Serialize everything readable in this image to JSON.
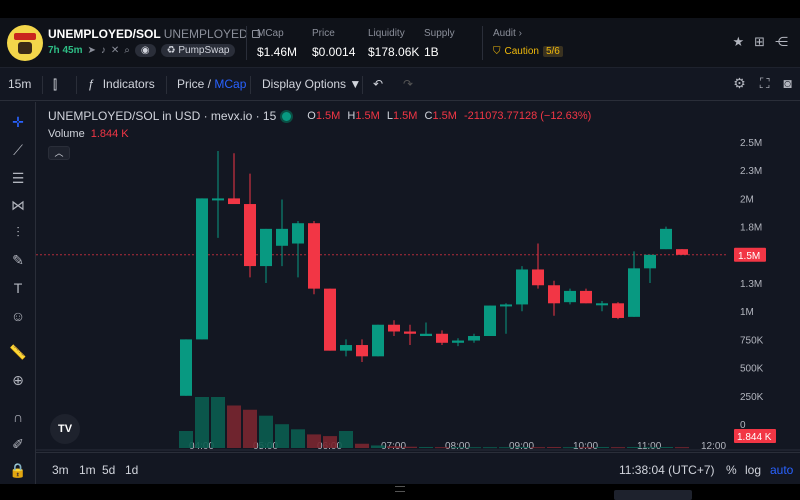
{
  "header": {
    "token_name": "UNEMPLOYED/SOL",
    "token_subname": "UNEMPLOYED",
    "age": "7h 45m",
    "dex_badge": "PumpSwap",
    "stats": [
      {
        "label": "MCap",
        "value": "$1.46M"
      },
      {
        "label": "Price",
        "value": "$0.0014"
      },
      {
        "label": "Liquidity",
        "value": "$178.06K"
      },
      {
        "label": "Supply",
        "value": "1B"
      }
    ],
    "audit_label": "Audit",
    "audit_status": "Caution",
    "audit_score": "5/6"
  },
  "toolbar": {
    "interval": "15m",
    "indicators": "Indicators",
    "price_label": "Price",
    "slash": " / ",
    "mcap_label": "MCap",
    "display_options": "Display Options ▼"
  },
  "legend": {
    "symbol": "UNEMPLOYED/SOL in USD · mevx.io · 15",
    "o_key": "O",
    "o_val": "1.5M",
    "h_key": "H",
    "h_val": "1.5M",
    "l_key": "L",
    "l_val": "1.5M",
    "c_key": "C",
    "c_val": "1.5M",
    "change": "-211073.77128 (−12.63%)",
    "volume_label": "Volume",
    "volume_value": "1.844 K",
    "tv_logo": "TV"
  },
  "chart_data": {
    "type": "candlestick",
    "y_unit": "market cap (USD)",
    "y_ticks": [
      "2.5M",
      "2.3M",
      "2M",
      "1.8M",
      "1.5M",
      "1.3M",
      "1M",
      "750K",
      "500K",
      "250K",
      "0"
    ],
    "x_ticks": [
      "04:00",
      "05:00",
      "06:00",
      "07:00",
      "08:00",
      "09:00",
      "10:00",
      "11:00",
      "12:00"
    ],
    "current_price_label": "1.5M",
    "current_volume_label": "1.844 K",
    "candles": [
      {
        "t": "03:45",
        "o": 250000,
        "h": 750000,
        "l": 250000,
        "c": 750000
      },
      {
        "t": "04:00",
        "o": 750000,
        "h": 2000000,
        "l": 750000,
        "c": 2000000
      },
      {
        "t": "04:15",
        "o": 2000000,
        "h": 2420000,
        "l": 1650000,
        "c": 2000000
      },
      {
        "t": "04:30",
        "o": 2000000,
        "h": 2400000,
        "l": 1950000,
        "c": 1950000
      },
      {
        "t": "04:45",
        "o": 1950000,
        "h": 2220000,
        "l": 1300000,
        "c": 1400000
      },
      {
        "t": "05:00",
        "o": 1400000,
        "h": 1730000,
        "l": 1250000,
        "c": 1730000
      },
      {
        "t": "05:15",
        "o": 1580000,
        "h": 1990000,
        "l": 1400000,
        "c": 1730000
      },
      {
        "t": "05:30",
        "o": 1600000,
        "h": 1800000,
        "l": 1300000,
        "c": 1780000
      },
      {
        "t": "05:45",
        "o": 1780000,
        "h": 1800000,
        "l": 1150000,
        "c": 1200000
      },
      {
        "t": "06:00",
        "o": 1200000,
        "h": 1200000,
        "l": 650000,
        "c": 650000
      },
      {
        "t": "06:15",
        "o": 650000,
        "h": 750000,
        "l": 600000,
        "c": 700000
      },
      {
        "t": "06:30",
        "o": 700000,
        "h": 750000,
        "l": 550000,
        "c": 600000
      },
      {
        "t": "06:45",
        "o": 600000,
        "h": 880000,
        "l": 600000,
        "c": 880000
      },
      {
        "t": "07:00",
        "o": 880000,
        "h": 920000,
        "l": 780000,
        "c": 820000
      },
      {
        "t": "07:15",
        "o": 820000,
        "h": 880000,
        "l": 700000,
        "c": 800000
      },
      {
        "t": "07:30",
        "o": 780000,
        "h": 900000,
        "l": 780000,
        "c": 800000
      },
      {
        "t": "07:45",
        "o": 800000,
        "h": 830000,
        "l": 700000,
        "c": 720000
      },
      {
        "t": "08:00",
        "o": 720000,
        "h": 760000,
        "l": 690000,
        "c": 740000
      },
      {
        "t": "08:15",
        "o": 740000,
        "h": 800000,
        "l": 720000,
        "c": 780000
      },
      {
        "t": "08:30",
        "o": 780000,
        "h": 1050000,
        "l": 780000,
        "c": 1050000
      },
      {
        "t": "08:45",
        "o": 1050000,
        "h": 1070000,
        "l": 800000,
        "c": 1060000
      },
      {
        "t": "09:00",
        "o": 1060000,
        "h": 1400000,
        "l": 1000000,
        "c": 1370000
      },
      {
        "t": "09:15",
        "o": 1370000,
        "h": 1600000,
        "l": 1200000,
        "c": 1230000
      },
      {
        "t": "09:30",
        "o": 1230000,
        "h": 1270000,
        "l": 960000,
        "c": 1070000
      },
      {
        "t": "09:45",
        "o": 1080000,
        "h": 1200000,
        "l": 1060000,
        "c": 1180000
      },
      {
        "t": "10:00",
        "o": 1180000,
        "h": 1200000,
        "l": 1070000,
        "c": 1070000
      },
      {
        "t": "10:15",
        "o": 1070000,
        "h": 1090000,
        "l": 1000000,
        "c": 1070000
      },
      {
        "t": "10:30",
        "o": 1070000,
        "h": 1080000,
        "l": 930000,
        "c": 940000
      },
      {
        "t": "10:45",
        "o": 950000,
        "h": 1530000,
        "l": 950000,
        "c": 1380000
      },
      {
        "t": "11:00",
        "o": 1380000,
        "h": 1500000,
        "l": 1250000,
        "c": 1500000
      },
      {
        "t": "11:15",
        "o": 1550000,
        "h": 1750000,
        "l": 1550000,
        "c": 1730000
      },
      {
        "t": "11:30",
        "o": 1550000,
        "h": 1550000,
        "l": 1500000,
        "c": 1500000
      }
    ],
    "volumes": [
      0.2,
      0.6,
      0.6,
      0.5,
      0.45,
      0.38,
      0.28,
      0.22,
      0.16,
      0.14,
      0.2,
      0.05,
      0.03,
      0.02,
      0.015,
      0.012,
      0.01,
      0.01,
      0.01,
      0.01,
      0.01,
      0.012,
      0.01,
      0.012,
      0.01,
      0.01,
      0.012,
      0.01,
      0.012,
      0.01,
      0.012,
      0.01
    ]
  },
  "bottom": {
    "ranges": [
      "3m",
      "1m",
      "5d",
      "1d"
    ],
    "clock": "11:38:04 (UTC+7)",
    "pct": "%",
    "log": "log",
    "auto": "auto"
  },
  "colors": {
    "up": "#089981",
    "down": "#f23645",
    "accent": "#2962ff",
    "caution": "#f0b90b"
  }
}
